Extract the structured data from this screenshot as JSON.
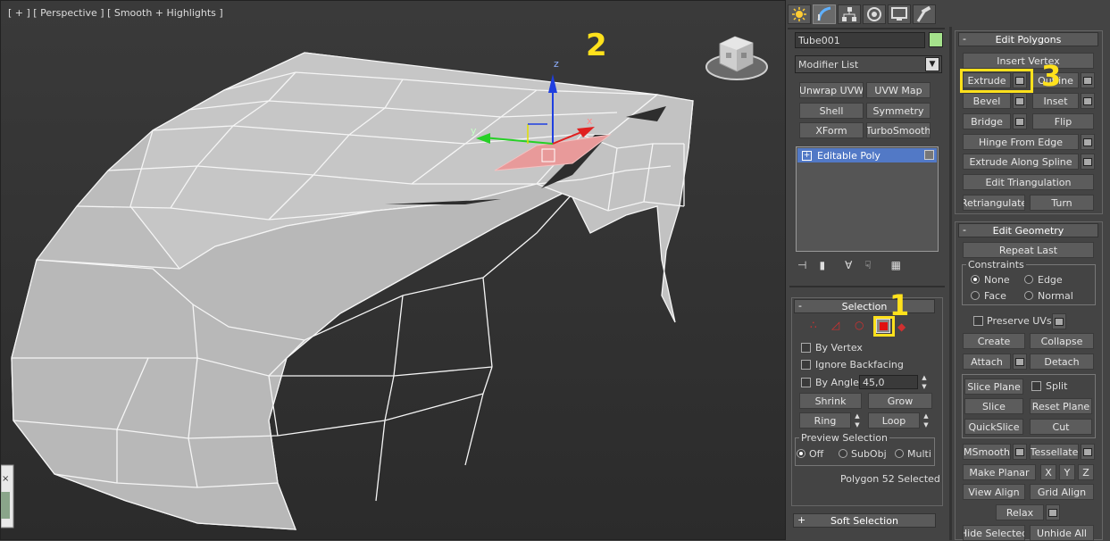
{
  "viewport": {
    "label": "[ + ] [ Perspective ] [ Smooth + Highlights ]",
    "gizmo_axes": {
      "x": "x",
      "y": "y",
      "z": "z"
    },
    "annotation_number": "2"
  },
  "command_panel": {
    "tabs": [
      {
        "name": "create-tab",
        "icon": "sun-icon"
      },
      {
        "name": "modify-tab",
        "icon": "modify-arc-icon"
      },
      {
        "name": "hierarchy-tab",
        "icon": "hierarchy-icon"
      },
      {
        "name": "motion-tab",
        "icon": "motion-circle-icon"
      },
      {
        "name": "display-tab",
        "icon": "display-monitor-icon"
      },
      {
        "name": "utilities-tab",
        "icon": "hammer-icon"
      }
    ],
    "object_name": "Tube001",
    "object_color": "#a5e28c",
    "modifier_list": "Modifier List",
    "modifier_buttons": [
      "Unwrap UVW",
      "UVW Map",
      "Shell",
      "Symmetry",
      "XForm",
      "TurboSmooth"
    ],
    "stack_item": "Editable Poly",
    "selection": {
      "title": "Selection",
      "by_vertex": "By Vertex",
      "ignore_backfacing": "Ignore Backfacing",
      "by_angle": "By Angle:",
      "angle_value": "45,0",
      "shrink": "Shrink",
      "grow": "Grow",
      "ring": "Ring",
      "loop": "Loop",
      "preview_title": "Preview Selection",
      "preview_off": "Off",
      "preview_subobj": "SubObj",
      "preview_multi": "Multi",
      "status": "Polygon 52 Selected",
      "annotation_number": "1"
    },
    "soft_selection": "Soft Selection",
    "edit_polygons": {
      "title": "Edit Polygons",
      "insert_vertex": "Insert Vertex",
      "extrude": "Extrude",
      "outline": "Outline",
      "bevel": "Bevel",
      "inset": "Inset",
      "bridge": "Bridge",
      "flip": "Flip",
      "hinge": "Hinge From Edge",
      "extrude_spline": "Extrude Along Spline",
      "edit_triangulation": "Edit Triangulation",
      "retriangulate": "Retriangulate",
      "turn": "Turn",
      "annotation_number": "3"
    },
    "edit_geometry": {
      "title": "Edit Geometry",
      "repeat_last": "Repeat Last",
      "constraints_title": "Constraints",
      "none": "None",
      "edge": "Edge",
      "face": "Face",
      "normal": "Normal",
      "preserve_uvs": "Preserve UVs",
      "create": "Create",
      "collapse": "Collapse",
      "attach": "Attach",
      "detach": "Detach",
      "slice_plane": "Slice Plane",
      "split": "Split",
      "slice": "Slice",
      "reset_plane": "Reset Plane",
      "quickslice": "QuickSlice",
      "cut": "Cut",
      "msmooth": "MSmooth",
      "tessellate": "Tessellate",
      "make_planar": "Make Planar",
      "x": "X",
      "y": "Y",
      "z": "Z",
      "view_align": "View Align",
      "grid_align": "Grid Align",
      "relax": "Relax",
      "hide_selected": "Hide Selected",
      "unhide_all": "Unhide All"
    }
  },
  "colors": {
    "annotation": "#ffe11c",
    "selected_face": "#e89a9a",
    "stack_highlight": "#5279c6"
  }
}
